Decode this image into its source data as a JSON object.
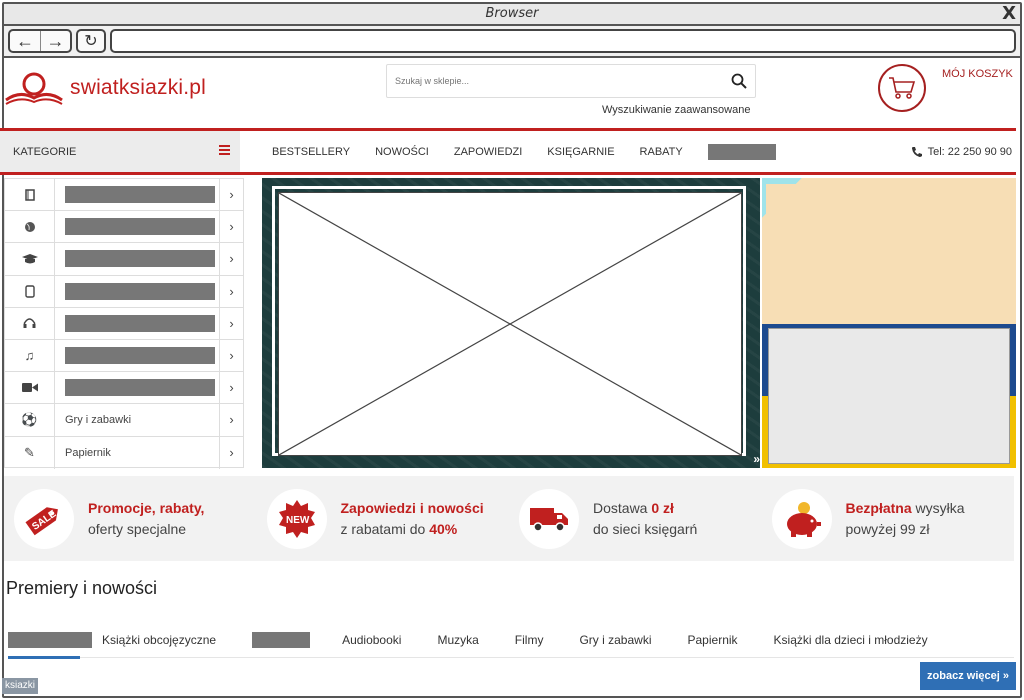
{
  "browser": {
    "title": "Browser",
    "close_glyph": "X",
    "back_glyph": "←",
    "forward_glyph": "→",
    "reload_glyph": "↻",
    "address": ""
  },
  "header": {
    "logo_text": "swiatksiazki.pl",
    "search_placeholder": "Szukaj w sklepie...",
    "advanced_search": "Wyszukiwanie zaawansowane",
    "cart_label": "MÓJ KOSZYK"
  },
  "menu": {
    "categories_label": "KATEGORIE",
    "items": [
      "BESTSELLERY",
      "NOWOŚCI",
      "ZAPOWIEDZI",
      "KSIĘGARNIE",
      "RABATY"
    ],
    "phone": "Tel: 22 250 90 90"
  },
  "sidebar": {
    "items": [
      {
        "icon": "book-icon",
        "label": ""
      },
      {
        "icon": "globe-icon",
        "label": ""
      },
      {
        "icon": "graduation-cap-icon",
        "label": ""
      },
      {
        "icon": "tablet-icon",
        "label": ""
      },
      {
        "icon": "headphones-icon",
        "label": ""
      },
      {
        "icon": "music-note-icon",
        "label": ""
      },
      {
        "icon": "video-camera-icon",
        "label": ""
      },
      {
        "icon": "football-icon",
        "label": "Gry i zabawki"
      },
      {
        "icon": "pencil-icon",
        "label": "Papiernik"
      }
    ],
    "chevron": "›"
  },
  "hero": {
    "arrows": "»"
  },
  "features": [
    {
      "icon": "sale-tag-icon",
      "line1_red": "Promocje, rabaty,",
      "line2": "oferty specjalne"
    },
    {
      "icon": "new-badge-icon",
      "line1_red": "Zapowiedzi i nowości",
      "line2_prefix": "z rabatami do ",
      "line2_red": "40%"
    },
    {
      "icon": "delivery-truck-icon",
      "line1_prefix": "Dostawa ",
      "line1_red": "0 zł",
      "line2": "do sieci księgarń"
    },
    {
      "icon": "piggy-bank-icon",
      "line1_red": "Bezpłatna",
      "line1_suffix": " wysyłka",
      "line2": "powyżej 99 zł"
    }
  ],
  "premieres": {
    "title": "Premiery i nowości",
    "tabs": [
      "Książki obcojęzyczne",
      "Audiobooki",
      "Muzyka",
      "Filmy",
      "Gry i zabawki",
      "Papiernik",
      "Książki dla dzieci i młodzieży"
    ],
    "see_more": "zobacz więcej »"
  },
  "status_tag": "ksiazki",
  "colors": {
    "brand_red": "#c0201f",
    "accent_blue": "#2f6fb5",
    "cart_red": "#a52020"
  }
}
